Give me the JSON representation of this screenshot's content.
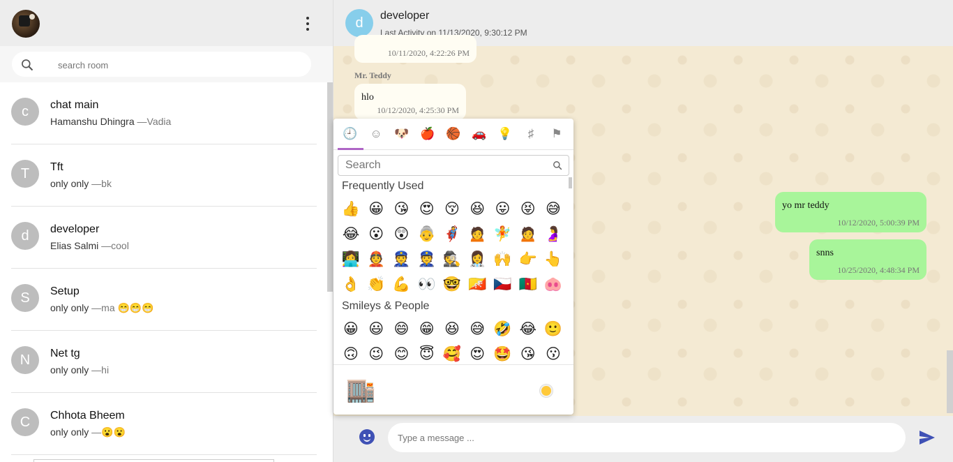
{
  "sidebar": {
    "search": {
      "placeholder": "search room"
    },
    "rooms": [
      {
        "initial": "c",
        "name": "chat main",
        "last_message": "Hamanshu Dhingra ",
        "last_sender": "—Vadia"
      },
      {
        "initial": "T",
        "name": "Tft",
        "last_message": "only only ",
        "last_sender": "—bk"
      },
      {
        "initial": "d",
        "name": "developer",
        "last_message": "Elias Salmi ",
        "last_sender": "—cool"
      },
      {
        "initial": "S",
        "name": "Setup",
        "last_message": "only only ",
        "last_sender": "—ma 😁😁😁"
      },
      {
        "initial": "N",
        "name": "Net tg",
        "last_message": "only only ",
        "last_sender": "—hi"
      },
      {
        "initial": "C",
        "name": "Chhota Bheem",
        "last_message": "only only ",
        "last_sender": "—😮😮"
      }
    ]
  },
  "chat": {
    "header": {
      "initial": "d",
      "title": "developer",
      "last_activity": "Last Activity on 11/13/2020, 9:30:12 PM"
    },
    "messages": [
      {
        "direction": "in",
        "sender": "",
        "text": "",
        "time": "10/11/2020, 4:22:26 PM"
      },
      {
        "direction": "in",
        "sender": "Mr. Teddy",
        "text": "hlo",
        "time": "10/12/2020, 4:25:30 PM"
      },
      {
        "direction": "out",
        "sender": "",
        "text": "yo mr teddy",
        "time": "10/12/2020, 5:00:39 PM"
      },
      {
        "direction": "out",
        "sender": "",
        "text": "snns",
        "time": "10/25/2020, 4:48:34 PM"
      }
    ],
    "composer": {
      "placeholder": "Type a message ..."
    }
  },
  "emoji_picker": {
    "categories": [
      {
        "icon": "clock-icon",
        "glyph": "🕘"
      },
      {
        "icon": "smiley-icon",
        "glyph": "☺"
      },
      {
        "icon": "dog-icon",
        "glyph": "🐶"
      },
      {
        "icon": "apple-icon",
        "glyph": "🍎"
      },
      {
        "icon": "basketball-icon",
        "glyph": "🏀"
      },
      {
        "icon": "car-icon",
        "glyph": "🚗"
      },
      {
        "icon": "lightbulb-icon",
        "glyph": "💡"
      },
      {
        "icon": "symbols-icon",
        "glyph": "♯"
      },
      {
        "icon": "flag-icon",
        "glyph": "⚑"
      }
    ],
    "search_placeholder": "Search",
    "sections": [
      {
        "title": "Frequently Used",
        "rows": [
          [
            "👍",
            "😀",
            "😘",
            "😍",
            "😚",
            "😆",
            "😛",
            "😝",
            "😅"
          ],
          [
            "😂",
            "😮",
            "😲",
            "👵",
            "🦸",
            "🙍",
            "🧚",
            "🙍",
            "🤰"
          ],
          [
            "👩‍💻",
            "👲",
            "👮",
            "👮",
            "🕵",
            "👩‍⚕️",
            "🙌",
            "👉",
            "👆"
          ],
          [
            "👌",
            "👏",
            "💪",
            "👀",
            "🤓",
            "🇧🇹",
            "🇨🇿",
            "🇨🇲",
            "🐽"
          ]
        ]
      },
      {
        "title": "Smileys & People",
        "rows": [
          [
            "😀",
            "😃",
            "😄",
            "😁",
            "😆",
            "😅",
            "🤣",
            "😂",
            "🙂"
          ],
          [
            "🙃",
            "😉",
            "😊",
            "😇",
            "🥰",
            "😍",
            "🤩",
            "😘",
            "😗"
          ]
        ]
      }
    ],
    "preview_emoji": "🏬",
    "skin_tone_color": "#ffc93a"
  }
}
